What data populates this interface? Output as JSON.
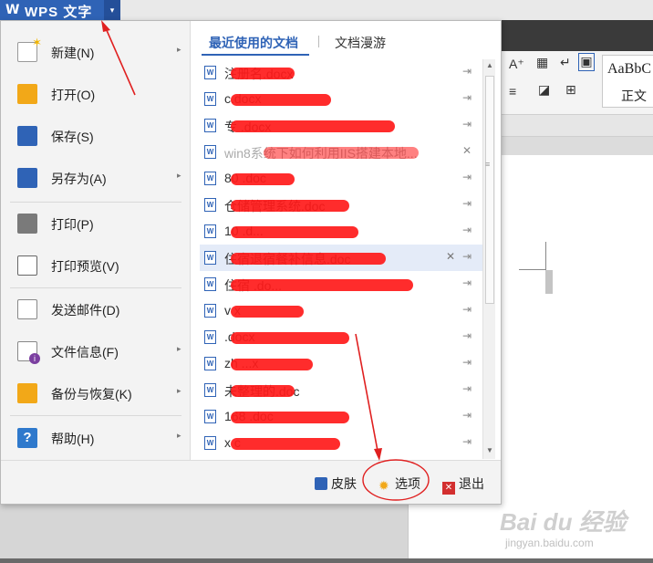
{
  "app": {
    "logo_glyph": "W",
    "title": "WPS 文字",
    "dropdown_glyph": "▾"
  },
  "ribbon": {
    "font_grow": "A⁺",
    "style_sample": "AaBbC",
    "style_name": "正文"
  },
  "menu": {
    "items": [
      {
        "label": "新建(N)",
        "icon": "new-document-icon",
        "has_submenu": true
      },
      {
        "label": "打开(O)",
        "icon": "open-folder-icon",
        "has_submenu": false
      },
      {
        "label": "保存(S)",
        "icon": "save-disk-icon",
        "has_submenu": false
      },
      {
        "label": "另存为(A)",
        "icon": "save-as-icon",
        "has_submenu": true
      },
      {
        "label": "打印(P)",
        "icon": "printer-icon",
        "has_submenu": false
      },
      {
        "label": "打印预览(V)",
        "icon": "print-preview-icon",
        "has_submenu": false
      },
      {
        "label": "发送邮件(D)",
        "icon": "mail-envelope-icon",
        "has_submenu": false
      },
      {
        "label": "文件信息(F)",
        "icon": "file-info-icon",
        "has_submenu": true
      },
      {
        "label": "备份与恢复(K)",
        "icon": "backup-restore-icon",
        "has_submenu": true
      },
      {
        "label": "帮助(H)",
        "icon": "help-icon",
        "has_submenu": true
      }
    ],
    "submenu_arrow": "▸"
  },
  "recent": {
    "tab_recent": "最近使用的文档",
    "tab_roaming": "文档漫游",
    "pin_glyph": "⇥",
    "remove_glyph": "✕",
    "files": [
      {
        "name": "注册名.docx",
        "selected": false,
        "dim": false
      },
      {
        "name": "c.docx",
        "selected": false,
        "dim": false
      },
      {
        "name": "专     .docx",
        "selected": false,
        "dim": false
      },
      {
        "name": "win8系统下如何利用IIS搭建本地...",
        "selected": false,
        "dim": true
      },
      {
        "name": "80         .doc",
        "selected": false,
        "dim": false
      },
      {
        "name": "仓储管理系统.doc",
        "selected": false,
        "dim": false
      },
      {
        "name": "10       .d...",
        "selected": false,
        "dim": false
      },
      {
        "name": "住宿退宿餐补信息.doc",
        "selected": true,
        "dim": false
      },
      {
        "name": "住宿        .do...",
        "selected": false,
        "dim": false
      },
      {
        "name": "v        x",
        "selected": false,
        "dim": false
      },
      {
        "name": "          .docx",
        "selected": false,
        "dim": false
      },
      {
        "name": "zh       ...x",
        "selected": false,
        "dim": false
      },
      {
        "name": "未整理的.doc",
        "selected": false,
        "dim": false
      },
      {
        "name": "168        .doc",
        "selected": false,
        "dim": false
      },
      {
        "name": "x          c",
        "selected": false,
        "dim": false
      }
    ]
  },
  "footer": {
    "skin_label": "皮肤",
    "options_label": "选项",
    "exit_label": "退出"
  },
  "watermark": {
    "main": "Bai du 经验",
    "sub": "jingyan.baidu.com"
  },
  "colors": {
    "wps_blue": "#2f63b6",
    "annotation_red": "#e02020",
    "selected_row": "#e4ebf8"
  }
}
